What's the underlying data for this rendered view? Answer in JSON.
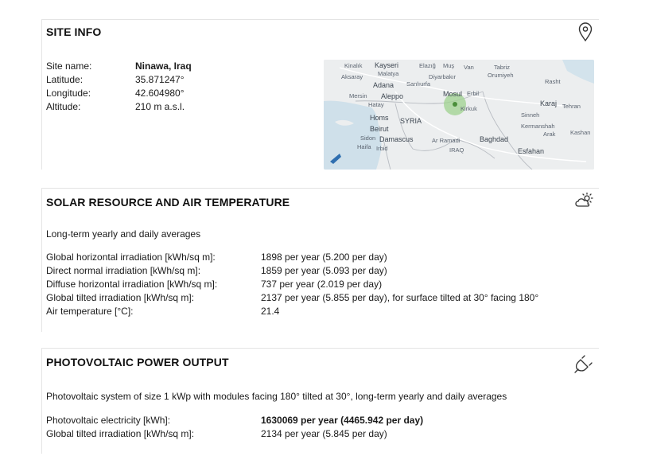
{
  "site_info": {
    "title": "SITE INFO",
    "icon": "location-pin-icon",
    "rows": [
      {
        "label": "Site name:",
        "value": "Ninawa, Iraq"
      },
      {
        "label": "Latitude:",
        "value": "35.871247°"
      },
      {
        "label": "Longitude:",
        "value": "42.604980°"
      },
      {
        "label": "Altitude:",
        "value": "210 m a.s.l."
      }
    ],
    "map": {
      "labels": {
        "kinalik": "Kinalık",
        "kayseri": "Kayseri",
        "elazig": "Elazığ",
        "mus": "Muş",
        "van": "Van",
        "tabriz": "Tabriz",
        "aksaray": "Aksaray",
        "malatya": "Malatya",
        "diyarbakir": "Diyarbakır",
        "urumiyeh": "Orumiyeh",
        "adana": "Adana",
        "sanliurfa": "Sanlıurfa",
        "rasht": "Rasht",
        "mersin": "Mersin",
        "aleppo": "Aleppo",
        "mosul": "Mosul",
        "erbil": "Erbil",
        "hatay": "Hatay",
        "karaj": "Karaj",
        "tehran": "Tehran",
        "kirkuk": "Kirkuk",
        "homs": "Homs",
        "syria": "SYRIA",
        "sinneh": "Sinneh",
        "beirut": "Beirut",
        "kermanshah": "Kermanshah",
        "arak": "Arak",
        "kashan": "Kashan",
        "sidon": "Sidon",
        "haifa": "Haifa",
        "damascus": "Damascus",
        "ramadi": "Ar Ramadi",
        "baghdad": "Baghdad",
        "irbid": "Irbid",
        "iraq": "IRAQ",
        "esfahan": "Esfahan"
      }
    }
  },
  "solar": {
    "title": "SOLAR RESOURCE AND AIR TEMPERATURE",
    "icon": "sun-cloud-icon",
    "subtitle": "Long-term yearly and daily averages",
    "rows": [
      {
        "label": "Global horizontal irradiation [kWh/sq m]:",
        "value": "1898 per year (5.200 per day)"
      },
      {
        "label": "Direct normal irradiation [kWh/sq m]:",
        "value": "1859 per year (5.093 per day)"
      },
      {
        "label": "Diffuse horizontal irradiation [kWh/sq m]:",
        "value": "737 per year (2.019 per day)"
      },
      {
        "label": "Global tilted irradiation [kWh/sq m]:",
        "value": "2137 per year (5.855 per day), for surface tilted at 30° facing 180°"
      },
      {
        "label": "Air temperature [°C]:",
        "value": "21.4"
      }
    ]
  },
  "pv": {
    "title": "PHOTOVOLTAIC POWER OUTPUT",
    "icon": "plug-icon",
    "subtitle": "Photovoltaic system of size 1 kWp with modules facing 180° tilted at 30°, long-term yearly and daily averages",
    "rows": [
      {
        "label": "Photovoltaic electricity [kWh]:",
        "value": "1630069 per year (4465.942 per day)"
      },
      {
        "label": "Global tilted irradiation [kWh/sq m]:",
        "value": "2134 per year (5.845 per day)"
      }
    ]
  }
}
